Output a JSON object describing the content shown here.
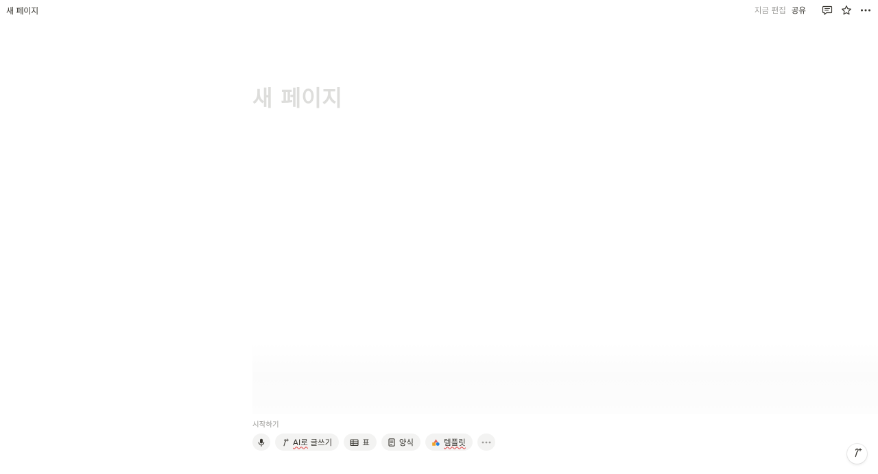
{
  "topbar": {
    "page_title": "새 페이지",
    "edited_label": "지금 편집",
    "share_label": "공유",
    "icons": [
      "comment-icon",
      "star-icon",
      "more-horizontal-icon"
    ]
  },
  "page": {
    "title_placeholder": "새 페이지"
  },
  "starter": {
    "label": "시작하기",
    "actions": [
      {
        "icon": "microphone-icon",
        "label": ""
      },
      {
        "icon": "ai-sparkle-icon",
        "label_prefix": "AI로",
        "label_suffix": " 글쓰기"
      },
      {
        "icon": "table-icon",
        "label": "표"
      },
      {
        "icon": "form-icon",
        "label": "양식"
      },
      {
        "icon": "templates-icon",
        "label": "템플릿"
      },
      {
        "icon": "more-horizontal-icon",
        "label": ""
      }
    ]
  },
  "colors": {
    "text": "#37352f",
    "muted": "#9b9a97",
    "placeholder": "#dddddb",
    "chip_bg": "#f3f3f2",
    "spell_error": "#e03e3e"
  }
}
